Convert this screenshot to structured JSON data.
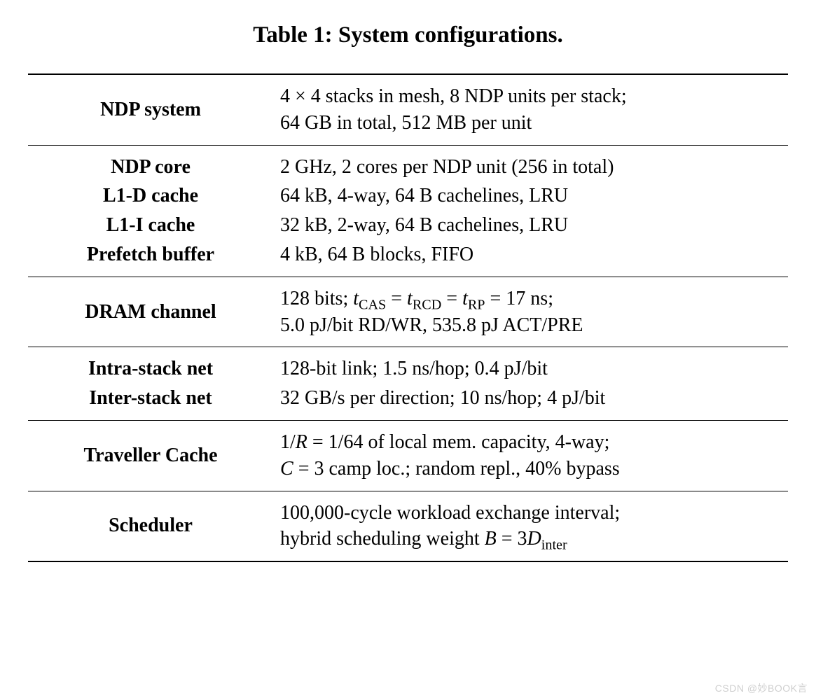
{
  "caption": "Table 1: System configurations.",
  "rows": {
    "ndp_system": {
      "label": "NDP system",
      "value_html": "4 × 4 stacks in mesh, 8 NDP units per stack;<br>64 GB in total, 512 MB per unit"
    },
    "ndp_core": {
      "label": "NDP core",
      "value_html": "2 GHz, 2 cores per NDP unit (256 in total)"
    },
    "l1d": {
      "label": "L1-D cache",
      "value_html": "64 kB, 4-way, 64 B cachelines, LRU"
    },
    "l1i": {
      "label": "L1-I cache",
      "value_html": "32 kB, 2-way, 64 B cachelines, LRU"
    },
    "prefetch": {
      "label": "Prefetch buffer",
      "value_html": "4 kB, 64 B blocks, FIFO"
    },
    "dram": {
      "label": "DRAM channel",
      "value_html": "128 bits; <span class=\"ital\">t</span><sub>CAS</sub> = <span class=\"ital\">t</span><sub>RCD</sub> = <span class=\"ital\">t</span><sub>RP</sub> = 17 ns;<br>5.0 pJ/bit RD/WR, 535.8 pJ ACT/PRE"
    },
    "intra": {
      "label": "Intra-stack net",
      "value_html": "128-bit link; 1.5 ns/hop; 0.4 pJ/bit"
    },
    "inter": {
      "label": "Inter-stack net",
      "value_html": "32 GB/s per direction; 10 ns/hop; 4 pJ/bit"
    },
    "traveller": {
      "label": "Traveller Cache",
      "value_html": "1/<span class=\"ital\">R</span> = 1/64 of local mem. capacity, 4-way;<br><span class=\"ital\">C</span> = 3 camp loc.; random repl., 40% bypass"
    },
    "scheduler": {
      "label": "Scheduler",
      "value_html": "100,000-cycle workload exchange interval;<br>hybrid scheduling weight <span class=\"ital\">B</span> = 3<span class=\"ital\">D</span><sub>inter</sub>"
    }
  },
  "watermark": "CSDN @妙BOOK言"
}
